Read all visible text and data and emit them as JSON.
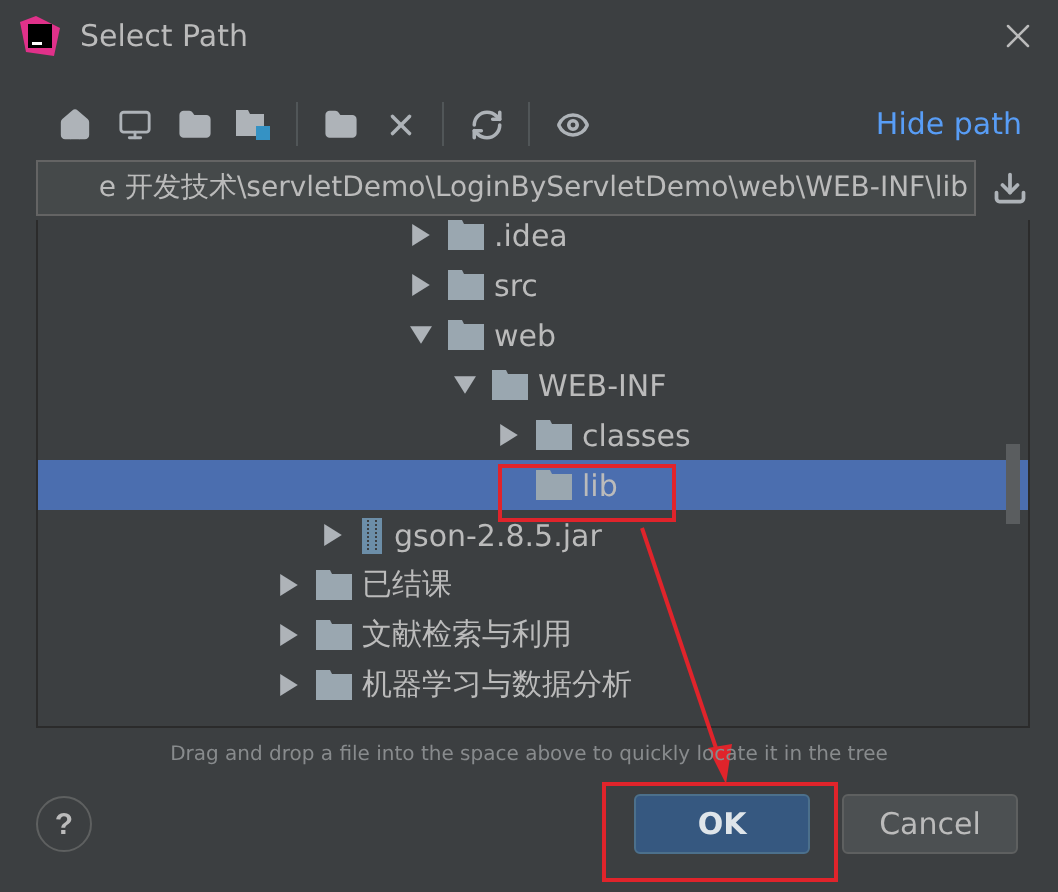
{
  "window": {
    "title": "Select Path"
  },
  "toolbar": {
    "link": "Hide path"
  },
  "path_field": {
    "value": "e 开发技术\\servletDemo\\LoginByServletDemo\\web\\WEB-INF\\lib"
  },
  "tree": [
    {
      "children": [
        {
          "children": [
            {
              "children": [
                {
                  "label": ".idea",
                  "kind": "folder",
                  "expanded": false,
                  "selected": false
                },
                {
                  "label": "src",
                  "kind": "folder",
                  "expanded": false,
                  "selected": false
                },
                {
                  "label": "web",
                  "kind": "folder",
                  "expanded": true,
                  "selected": false,
                  "children": [
                    {
                      "label": "WEB-INF",
                      "kind": "folder",
                      "expanded": true,
                      "selected": false,
                      "children": [
                        {
                          "label": "classes",
                          "kind": "folder",
                          "expanded": false,
                          "selected": false
                        },
                        {
                          "label": "lib",
                          "kind": "leaf",
                          "expanded": false,
                          "selected": true
                        }
                      ]
                    }
                  ]
                }
              ]
            }
          ]
        },
        {
          "label": "gson-2.8.5.jar",
          "kind": "jar",
          "expanded": false,
          "selected": false
        }
      ]
    },
    {
      "label": "已结课",
      "kind": "folder",
      "expanded": false,
      "selected": false
    },
    {
      "label": "文献检索与利用",
      "kind": "folder",
      "expanded": false,
      "selected": false
    },
    {
      "label": "机器学习与数据分析",
      "kind": "folder",
      "expanded": false,
      "selected": false
    }
  ],
  "hint": "Drag and drop a file into the space above to quickly locate it in the tree",
  "help": "?",
  "buttons": [
    {
      "label": "OK",
      "primary": true
    },
    {
      "label": "Cancel",
      "primary": false
    }
  ]
}
